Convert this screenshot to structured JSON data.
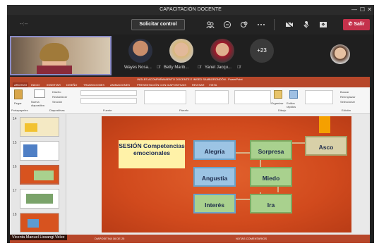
{
  "window": {
    "title": "CAPACITACIÓN DOCENTE"
  },
  "toolbar": {
    "dots_label": "--:--",
    "request_control_label": "Solicitar control",
    "leave_label": "Salir",
    "icons": [
      "participants-icon",
      "chat-icon",
      "reactions-icon",
      "more-icon",
      "camera-icon",
      "mic-icon",
      "share-icon"
    ]
  },
  "participants": [
    {
      "name": "Wayes Nosa..."
    },
    {
      "name": "Betty Marib..."
    },
    {
      "name": "Yanet Jacqu..."
    }
  ],
  "more_count": "+23",
  "ppt": {
    "title": "INGLES ACOMPAÑAMIENTO DOCENTE E IMSED SAMBORONDÓN - PowerPoint",
    "tabs": [
      "ARCHIVO",
      "INICIO",
      "INSERTAR",
      "DISEÑO",
      "TRANSICIONES",
      "ANIMACIONES",
      "PRESENTACIÓN CON DIAPOSITIVAS",
      "REVISAR",
      "VISTA"
    ],
    "ribbon": {
      "paste": "Pegar",
      "new_slide": "Nueva diapositiva",
      "design": "Diseño",
      "reset": "Restablecer",
      "section": "Sección",
      "arrange": "Organizar",
      "quick_styles": "Estilos rápidos",
      "find": "Buscar",
      "replace": "Reemplazar",
      "select": "Seleccionar",
      "groups": [
        "Portapapeles",
        "Diapositivas",
        "Fuente",
        "Párrafo",
        "Dibujo",
        "Edición"
      ]
    },
    "thumb_numbers": [
      "14",
      "15",
      "16",
      "17",
      "18"
    ],
    "slide": {
      "title": "SESIÓN Competencias emocionales",
      "boxes": [
        "Alegría",
        "Sorpresa",
        "Asco",
        "Angustia",
        "Miedo",
        "Interés",
        "Ira"
      ]
    },
    "status": "DIAPOSITIVA 16 DE 25",
    "status_right": "NOTAS   COMENTARIOS"
  },
  "speaker_name": "Vicenta Manuel Lissangi Velez"
}
